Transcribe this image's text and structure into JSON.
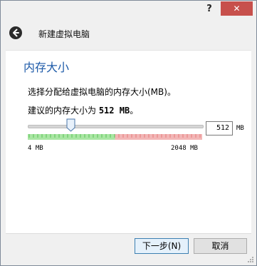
{
  "window": {
    "help_label": "?",
    "close_label": "✕"
  },
  "header": {
    "title": "新建虚拟电脑"
  },
  "page": {
    "title": "内存大小",
    "description": "选择分配给虚拟电脑的内存大小(MB)。",
    "recommend_prefix": "建议的内存大小为 ",
    "recommend_value": "512 MB",
    "recommend_suffix": "。"
  },
  "slider": {
    "min_label": "4 MB",
    "max_label": "2048 MB",
    "min": 4,
    "max": 2048,
    "value": 512,
    "safe_fraction": 0.5,
    "colors": {
      "green": "#a9e6a3",
      "red": "#f2b6b6"
    }
  },
  "memory_input": {
    "value": "512",
    "unit": "MB"
  },
  "buttons": {
    "next": "下一步(N)",
    "cancel": "取消"
  },
  "colors": {
    "accent": "#1d5aa8",
    "close": "#c7504c"
  }
}
